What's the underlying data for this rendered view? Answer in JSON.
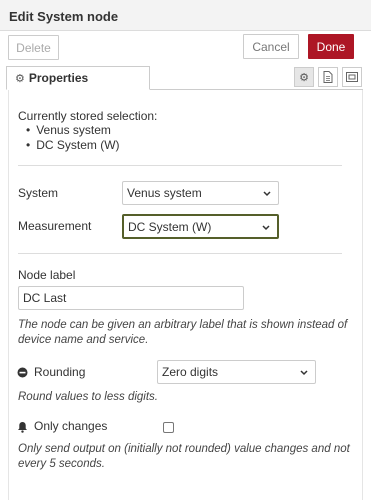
{
  "header": {
    "title": "Edit System node"
  },
  "actions": {
    "delete_label": "Delete",
    "cancel_label": "Cancel",
    "done_label": "Done"
  },
  "tabs": {
    "properties_label": "Properties"
  },
  "icons": {
    "settings": "gear-icon",
    "description": "document-icon",
    "appearance": "frame-icon"
  },
  "stored": {
    "title": "Currently stored selection:",
    "items": [
      "Venus system",
      "DC System (W)"
    ]
  },
  "form": {
    "system": {
      "label": "System",
      "value": "Venus system"
    },
    "measurement": {
      "label": "Measurement",
      "value": "DC System (W)"
    },
    "node_label": {
      "label": "Node label",
      "value": "DC Last",
      "help": "The node can be given an arbitrary label that is shown instead of device name and service."
    },
    "rounding": {
      "label": "Rounding",
      "value": "Zero digits",
      "help": "Round values to less digits."
    },
    "only_changes": {
      "label": "Only changes",
      "checked": false,
      "help": "Only send output on (initially not rounded) value changes and not every 5 seconds."
    }
  },
  "colors": {
    "primary": "#ad1625",
    "focus_border": "#555f2a"
  }
}
